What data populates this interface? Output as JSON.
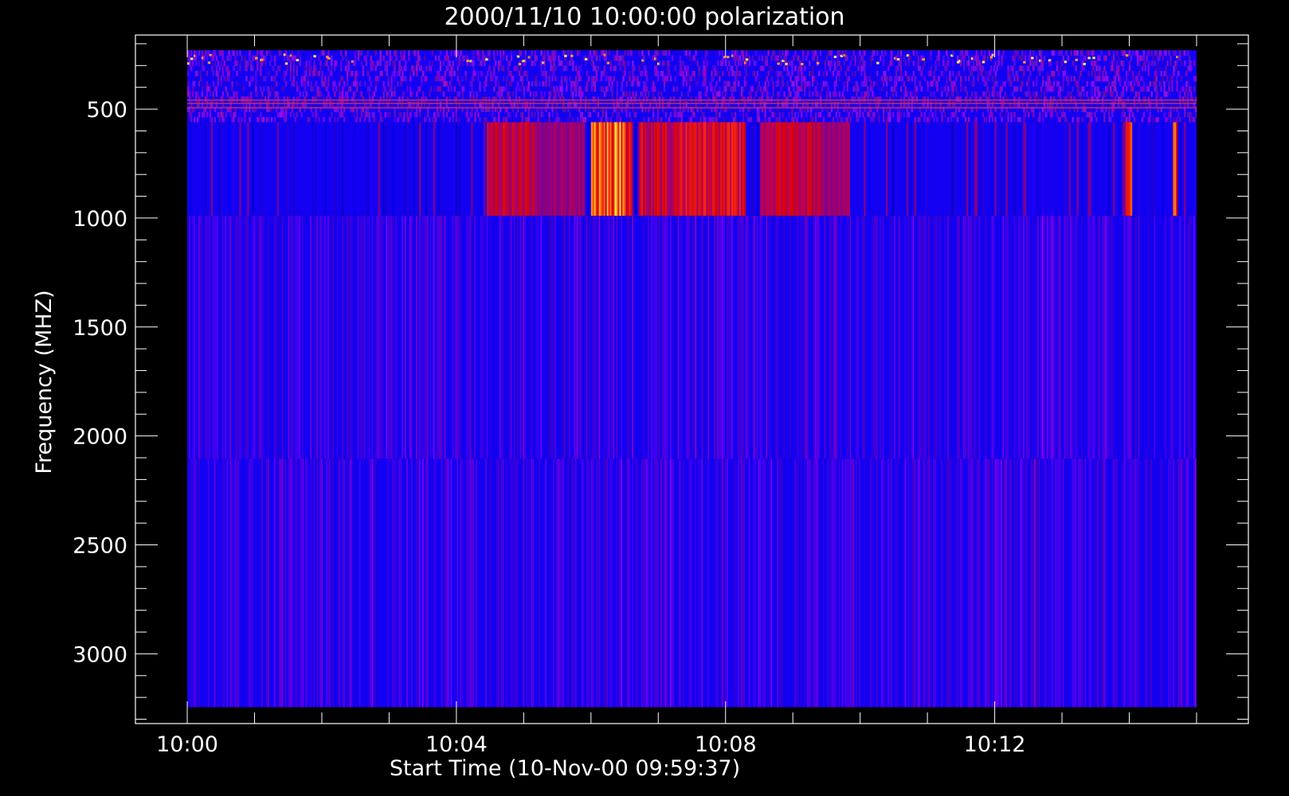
{
  "chart_data": {
    "type": "heatmap",
    "title": "2000/11/10 10:00:00 polarization",
    "xlabel": "Start Time (10-Nov-00 09:59:37)",
    "ylabel": "Frequency (MHZ)",
    "x_major_ticks": [
      "10:00",
      "10:04",
      "10:08",
      "10:12"
    ],
    "x_major_minutes": [
      0,
      4,
      8,
      12
    ],
    "x_minor_step_minutes": 1,
    "xlim_minutes": [
      -0.77,
      15.77
    ],
    "data_time_range_minutes": [
      0,
      15
    ],
    "y_major_ticks": [
      "500",
      "1000",
      "1500",
      "2000",
      "2500",
      "3000"
    ],
    "y_major_values": [
      500,
      1000,
      1500,
      2000,
      2500,
      3000
    ],
    "y_minor_step": 100,
    "ylim": [
      3320,
      160
    ],
    "frequency_bands": [
      {
        "from": 230,
        "to": 560,
        "style": "noisy"
      },
      {
        "from": 560,
        "to": 990,
        "style": "bursts"
      },
      {
        "from": 990,
        "to": 2105,
        "style": "striped"
      },
      {
        "from": 2105,
        "to": 3245,
        "style": "striped"
      }
    ],
    "burst_intervals_minutes": [
      {
        "start": 4.45,
        "end": 5.2,
        "intensity": 0.45
      },
      {
        "start": 5.2,
        "end": 5.9,
        "intensity": 0.3
      },
      {
        "start": 6.0,
        "end": 6.6,
        "intensity": 0.9
      },
      {
        "start": 6.7,
        "end": 7.3,
        "intensity": 0.5
      },
      {
        "start": 7.3,
        "end": 8.3,
        "intensity": 0.7
      },
      {
        "start": 8.5,
        "end": 9.4,
        "intensity": 0.45
      },
      {
        "start": 9.4,
        "end": 9.85,
        "intensity": 0.3
      },
      {
        "start": 13.95,
        "end": 14.05,
        "intensity": 1.0
      },
      {
        "start": 14.65,
        "end": 14.72,
        "intensity": 1.0
      }
    ],
    "colors": {
      "background": "#000000",
      "base": "#1400f0",
      "hot": "#ff7a1a",
      "axis": "#ffffff"
    },
    "grid": false
  }
}
